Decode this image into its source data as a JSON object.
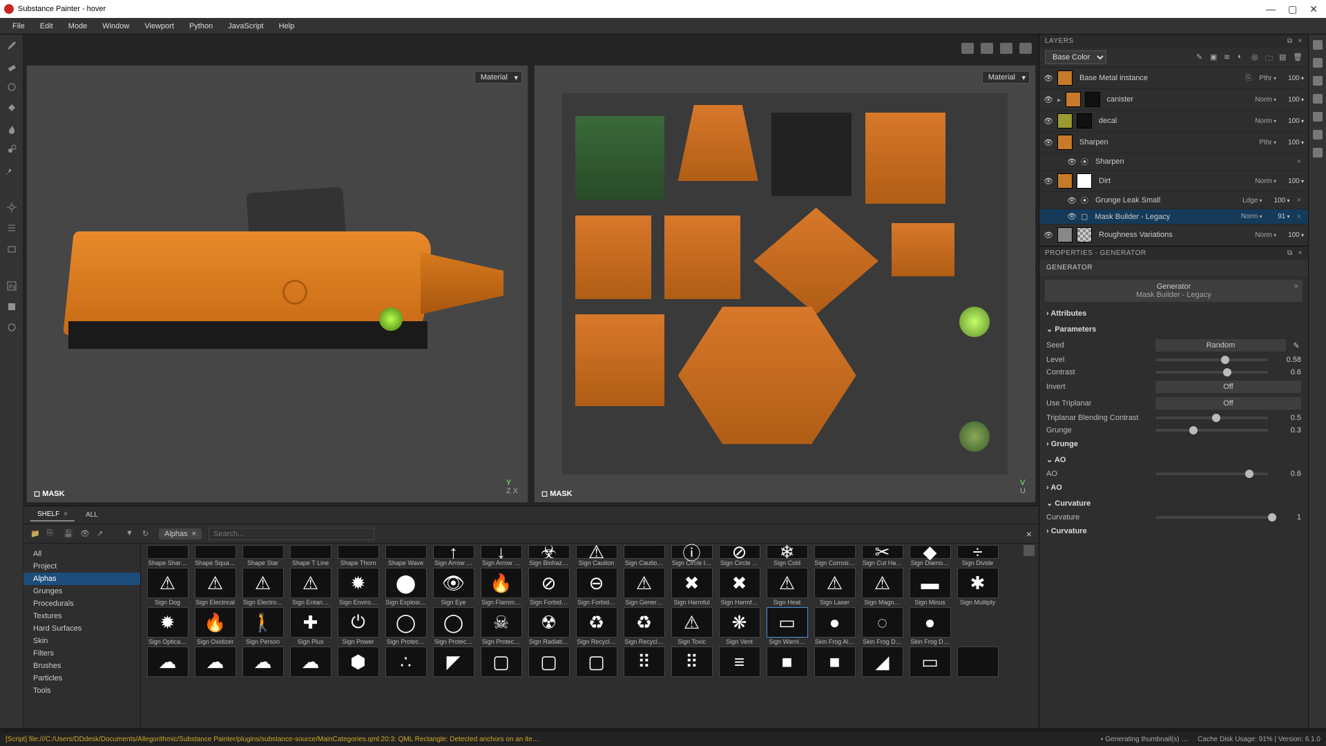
{
  "app": {
    "title": "Substance Painter - hover"
  },
  "menu": [
    "File",
    "Edit",
    "Mode",
    "Window",
    "Viewport",
    "Python",
    "JavaScript",
    "Help"
  ],
  "viewport": {
    "dropdown": "Material",
    "mask_label": "MASK",
    "axis1": "Z     X",
    "axis2": "U",
    "axisY": "Y"
  },
  "shelf": {
    "tabs": [
      {
        "label": "Shelf",
        "active": true
      },
      {
        "label": "All",
        "active": false
      }
    ],
    "filter_chip": "Alphas",
    "search_placeholder": "Search...",
    "categories": [
      "All",
      "Project",
      "Alphas",
      "Grunges",
      "Procedurals",
      "Textures",
      "Hard Surfaces",
      "Skin",
      "Filters",
      "Brushes",
      "Particles",
      "Tools"
    ],
    "selected_cat": "Alphas",
    "rows": [
      [
        "Shape Shar…",
        "Shape Squa…",
        "Shape Star",
        "Shape T Line",
        "Shape Thorn",
        "Shape Wave",
        "Sign Arrow …",
        "Sign Arrow …",
        "Sign Biohaz…",
        "Sign Caution",
        "Sign Cautio…",
        "Sign Circle I…",
        "Sign Circle …",
        "Sign Cold",
        "Sign Corrosi…",
        "Sign Cut Ha…",
        "Sign Diamo…",
        "Sign Divide"
      ],
      [
        "Sign Dog",
        "Sign Electrical",
        "Sign Electro…",
        "Sign Entan…",
        "Sign Enviro…",
        "Sign Explosi…",
        "Sign Eye",
        "Sign Flamm…",
        "Sign Forbid…",
        "Sign Forbid…",
        "Sign Gener…",
        "Sign Harmful",
        "Sign Harmf…",
        "Sign Heat",
        "Sign Laser",
        "Sign Magn…",
        "Sign Minus",
        "Sign Multiply"
      ],
      [
        "Sign Optica…",
        "Sign Oxidizer",
        "Sign Person",
        "Sign Plus",
        "Sign Power",
        "Sign Protec…",
        "Sign Protec…",
        "Sign Protec…",
        "Sign Radiati…",
        "Sign Recycl…",
        "Sign Recycl…",
        "Sign Toxic",
        "Sign Vent",
        "Sign Warni…",
        "Skin Frog Al…",
        "Skin Frog D…",
        "Skin Frog D…"
      ],
      [
        "",
        "",
        "",
        "",
        "",
        "",
        "",
        "",
        "",
        "",
        "",
        "",
        "",
        "",
        "",
        "",
        "",
        ""
      ]
    ],
    "glyphs": [
      [
        "",
        "",
        "",
        "",
        "",
        "",
        "↑",
        "↓",
        "☣",
        "⚠",
        "",
        "ⓘ",
        "⊘",
        "❄",
        "",
        "✂",
        "◆",
        "÷"
      ],
      [
        "⚠",
        "⚠",
        "⚠",
        "⚠",
        "✹",
        "⬤",
        "👁",
        "🔥",
        "⊘",
        "⊖",
        "⚠",
        "✖",
        "✖",
        "⚠",
        "⚠",
        "⚠",
        "▬",
        "✱"
      ],
      [
        "✹",
        "🔥",
        "🚶",
        "✚",
        "⏻",
        "◯",
        "◯",
        "☠",
        "☢",
        "♻",
        "♻",
        "⚠",
        "❋",
        "▭",
        "●",
        "◌",
        "●"
      ],
      [
        "☁",
        "☁",
        "☁",
        "☁",
        "⬢",
        "∴",
        "◤",
        "▢",
        "▢",
        "▢",
        "⠿",
        "⠿",
        "≡",
        "■",
        "■",
        "◢",
        "▭"
      ]
    ]
  },
  "layers": {
    "title": "LAYERS",
    "channel": "Base Color",
    "items": [
      {
        "name": "Base Metal instance",
        "blend": "Pthr",
        "op": "100",
        "sw": "#c77a2a",
        "copy": true
      },
      {
        "name": "canister",
        "blend": "Norm",
        "op": "100",
        "sw": "#c77a2a",
        "mask": true,
        "folder": true
      },
      {
        "name": "decal",
        "blend": "Norm",
        "op": "100",
        "sw": "#9a9a30",
        "mask": true
      },
      {
        "name": "Sharpen",
        "blend": "Pthr",
        "op": "100",
        "sw": "#c77a2a"
      },
      {
        "name": "Sharpen",
        "blend": "",
        "op": "",
        "indent": 1,
        "fx": true,
        "x": true
      },
      {
        "name": "Dirt",
        "blend": "Norm",
        "op": "100",
        "sw": "#c77a2a",
        "mask": true,
        "maskbw": true
      },
      {
        "name": "Grunge Leak Small",
        "blend": "Ldge",
        "op": "100",
        "indent": 1,
        "fx": true,
        "x": true
      },
      {
        "name": "Mask Builder - Legacy",
        "blend": "Norm",
        "op": "91",
        "indent": 1,
        "fx": true,
        "sel": true,
        "x": true,
        "box": true
      },
      {
        "name": "Roughness Variations",
        "blend": "Norm",
        "op": "100",
        "sw": "#888",
        "mask": true,
        "maskchk": true
      }
    ]
  },
  "props": {
    "title": "PROPERTIES - GENERATOR",
    "section": "GENERATOR",
    "gen": {
      "label": "Generator",
      "name": "Mask Builder - Legacy"
    },
    "groups": [
      {
        "label": "Attributes",
        "open": false
      },
      {
        "label": "Parameters",
        "open": true,
        "rows": [
          {
            "type": "btn",
            "label": "Seed",
            "btn": "Random",
            "pen": true
          },
          {
            "type": "slider",
            "label": "Level",
            "val": "0.58",
            "pos": 58
          },
          {
            "type": "slider",
            "label": "Contrast",
            "val": "0.6",
            "pos": 60
          },
          {
            "type": "btn",
            "label": "Invert",
            "btn": "Off"
          },
          {
            "type": "btn",
            "label": "Use Triplanar",
            "btn": "Off"
          },
          {
            "type": "slider",
            "label": "Triplanar Blending Contrast",
            "val": "0.5",
            "pos": 50
          },
          {
            "type": "slider",
            "label": "Grunge",
            "val": "0.3",
            "pos": 30
          }
        ]
      },
      {
        "label": "Grunge",
        "open": false
      },
      {
        "label": "AO",
        "open": true,
        "rows": [
          {
            "type": "slider",
            "label": "AO",
            "val": "0.6",
            "pos": 80
          }
        ]
      },
      {
        "label": "AO",
        "open": false
      },
      {
        "label": "Curvature",
        "open": true,
        "rows": [
          {
            "type": "slider",
            "label": "Curvature",
            "val": "1",
            "pos": 100
          }
        ]
      },
      {
        "label": "Curvature",
        "open": false
      }
    ]
  },
  "status": {
    "script": "[Script] file:///C:/Users/DDdesk/Documents/Allegorithmic/Substance Painter/plugins/substance-source/MainCategories.qml:20:3: QML Rectangle: Detected anchors on an ite…",
    "gen": "Generating thumbnail(s) …",
    "cache": "Cache Disk Usage:   91% | Version: 6.1.0"
  }
}
